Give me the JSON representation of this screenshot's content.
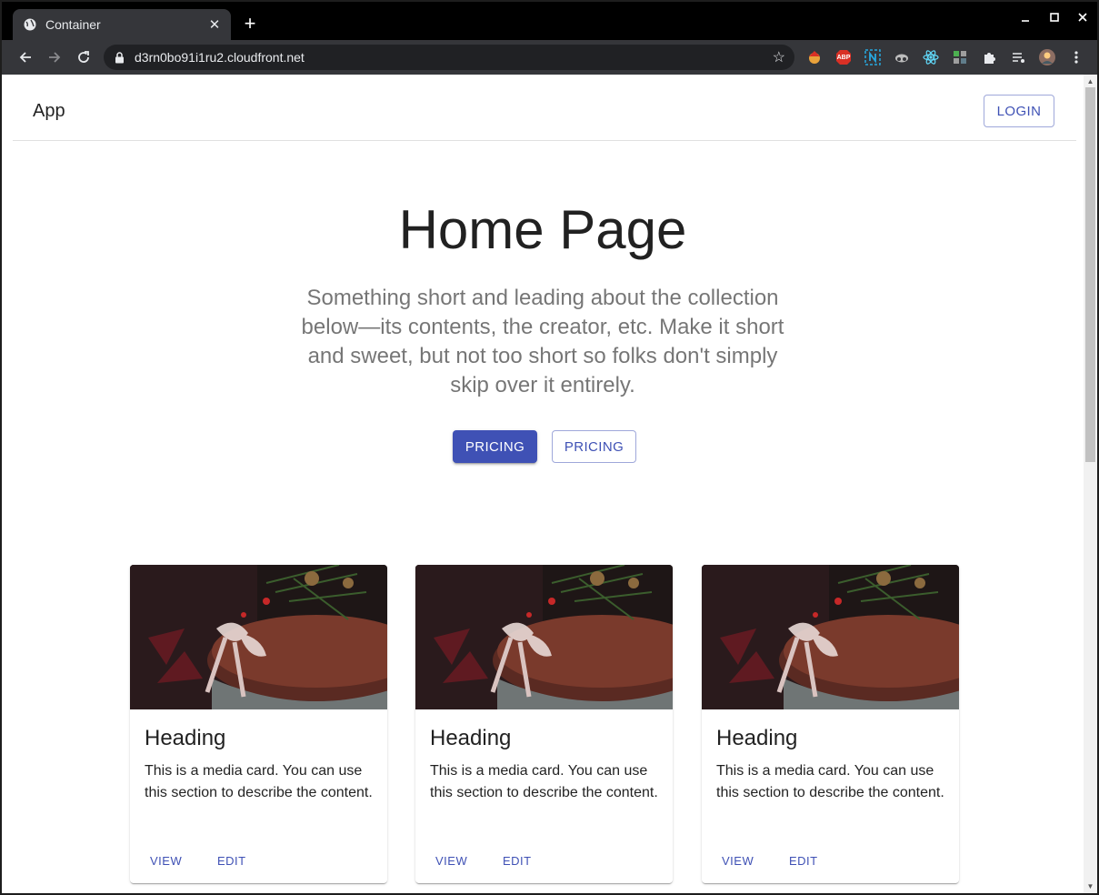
{
  "browser": {
    "tab_title": "Container",
    "tab_close": "✕",
    "new_tab": "+",
    "url": "d3rn0bo91i1ru2.cloudfront.net",
    "extensions": [
      "ABP"
    ]
  },
  "app": {
    "title": "App",
    "login_label": "LOGIN"
  },
  "hero": {
    "title": "Home Page",
    "description": "Something short and leading about the collection below—its contents, the creator, etc. Make it short and sweet, but not too short so folks don't simply skip over it entirely.",
    "primary_button": "PRICING",
    "secondary_button": "PRICING"
  },
  "cards": [
    {
      "heading": "Heading",
      "body": "This is a media card. You can use this section to describe the content.",
      "view_label": "VIEW",
      "edit_label": "EDIT"
    },
    {
      "heading": "Heading",
      "body": "This is a media card. You can use this section to describe the content.",
      "view_label": "VIEW",
      "edit_label": "EDIT"
    },
    {
      "heading": "Heading",
      "body": "This is a media card. You can use this section to describe the content.",
      "view_label": "VIEW",
      "edit_label": "EDIT"
    }
  ],
  "colors": {
    "primary": "#3f51b5",
    "chrome_dark": "#35363a"
  }
}
